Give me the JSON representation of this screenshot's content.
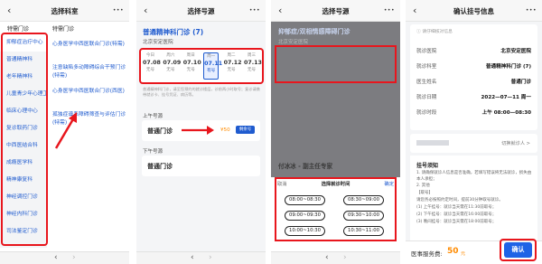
{
  "screen1": {
    "title": "选择科室",
    "nav_more": "•••",
    "group_label": "特需门诊",
    "departments": [
      "抑郁症治疗中心",
      "普通精神科",
      "老年精神科",
      "儿童青少年心理卫生中心",
      "临床心理中心",
      "复诊取药门诊",
      "中西医结合科",
      "成瘾医学科",
      "精神康复科",
      "神经调控门诊",
      "神经内科门诊",
      "司法鉴定门诊"
    ],
    "sub_group_label": "特需门诊",
    "sub_departments": [
      "心身医学中西医联合门诊(特需)",
      "注意缺陷多动障碍综合干预门诊(特需)",
      "心身医学中西医联合门诊(西医)",
      "孤独症谱系障碍筛查与评估门诊(特需)"
    ]
  },
  "screen2": {
    "title": "选择号源",
    "nav_more": "•••",
    "dept_name": "普通精神科门诊 (7)",
    "hospital": "北京安定医院",
    "hospital_area": "北京安定医院",
    "dates": [
      {
        "dow": "今日",
        "date": "07.08",
        "status": "无号"
      },
      {
        "dow": "周六",
        "date": "07.09",
        "status": "无号"
      },
      {
        "dow": "周日",
        "date": "07.10",
        "status": "无号"
      },
      {
        "dow": "周一",
        "date": "07.11",
        "status": "有号"
      },
      {
        "dow": "周二",
        "date": "07.12",
        "status": "无号"
      },
      {
        "dow": "周三",
        "date": "07.13",
        "status": "无号"
      }
    ],
    "notice": "普通精神科门诊，请至您预约的就诊楼层，诊前两小时取号；复诊请携带就诊卡、挂号凭证、病历等。",
    "am_label": "上午号源",
    "am_slot_name": "普通门诊",
    "am_price": "¥50",
    "am_btn": "剩余号",
    "pm_label": "下午号源",
    "pm_slot_name": "普通门诊"
  },
  "screen3": {
    "title": "选择号源",
    "nav_more": "•••",
    "dim_dept": "抑郁症/双相情感障碍门诊",
    "dim_hospital": "北京安定医院",
    "dim_doctor": "付冰冰 - 副主任专家",
    "sheet_cancel": "取消",
    "sheet_title": "选择就诊时间",
    "sheet_confirm": "确定",
    "times": [
      "08:00~08:30",
      "08:30~09:00",
      "09:00~09:30",
      "09:30~10:00",
      "10:00~10:30",
      "10:30~11:00"
    ]
  },
  "screen4": {
    "title": "确认挂号信息",
    "nav_more": "•••",
    "tip": "请仔细核对信息",
    "rows": [
      {
        "label": "就诊医院",
        "value": "北京安定医院"
      },
      {
        "label": "就诊科室",
        "value": "普通精神科门诊 (7)"
      },
      {
        "label": "医生姓名",
        "value": "普通门诊"
      },
      {
        "label": "就诊日期",
        "value": "2022—07—11 周一"
      },
      {
        "label": "就诊时段",
        "value": "上午 08:00—08:30"
      }
    ],
    "switch_patient": "切换就诊人 >",
    "guide_title": "挂号须知",
    "guide_lines": [
      "1. 请确保就诊人信息是否准确，若填写错误将无法就诊，损失由本人承担；",
      "2. 其他",
      "【取号】",
      "请您务必按照约定时间，提前30分钟取号就诊。",
      "(1) 上午挂号：就诊当天需在11:30前取号；",
      "(2) 下午挂号：就诊当天需在16:00前取号；",
      "(3) 晚间挂号：就诊当天需在18:00前取号；"
    ],
    "fee_label": "医事服务费:",
    "fee_value": "50",
    "fee_unit": "元",
    "confirm": "确认"
  },
  "colors": {
    "accent": "#1f5bcf",
    "highlight": "#e8161d",
    "price": "#ff8b00",
    "confirm_button": "#1f63e6"
  }
}
